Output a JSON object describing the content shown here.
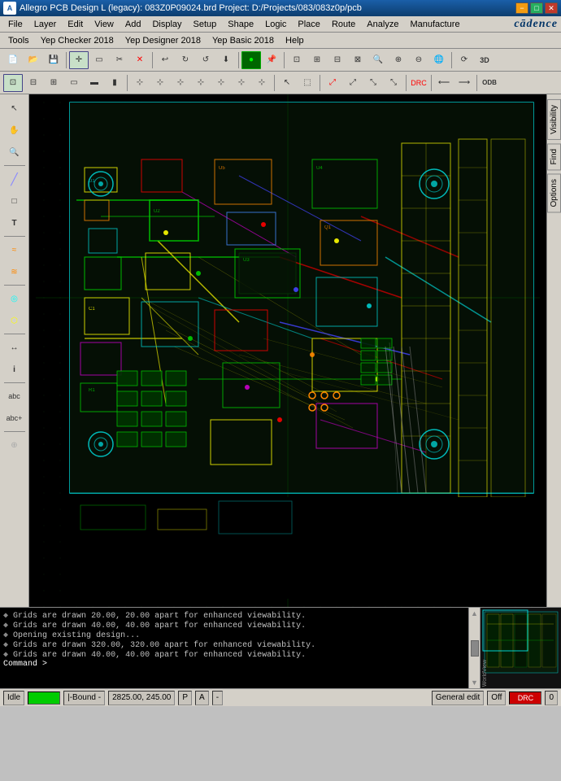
{
  "titlebar": {
    "icon": "A",
    "title": "Allegro PCB Design L (legacy): 083Z0P09024.brd  Project: D:/Projects/083/083z0p/pcb",
    "btn_min": "−",
    "btn_max": "□",
    "btn_close": "✕"
  },
  "menubar1": {
    "items": [
      "File",
      "Layer",
      "Edit",
      "View",
      "Add",
      "Display",
      "Setup",
      "Shape",
      "Logic",
      "Place",
      "Route",
      "Analyze",
      "Manufacture"
    ]
  },
  "menubar2": {
    "items": [
      "Tools",
      "Yep Checker 2018",
      "Yep Designer 2018",
      "Yep Basic 2018",
      "Help"
    ]
  },
  "right_panel": {
    "tabs": [
      "Visibility",
      "Find",
      "Options"
    ]
  },
  "console": {
    "lines": [
      "Grids are drawn 20.00, 20.00 apart for enhanced viewability.",
      "Grids are drawn 40.00, 40.00 apart for enhanced viewability.",
      "Opening existing design...",
      "Grids are drawn 320.00, 320.00 apart for enhanced viewability.",
      "Grids are drawn 40.00, 40.00 apart for enhanced viewability.",
      "Command >"
    ],
    "label_prefix": "Command"
  },
  "minimap": {
    "label": "WorldView"
  },
  "statusbar": {
    "idle": "Idle",
    "green_indicator": "",
    "bound_label": "|-Bound -",
    "coordinates": "2825.00, 245.00",
    "p_label": "P",
    "a_label": "A",
    "dash": "-",
    "general_edit": "General edit",
    "off": "Off",
    "red_indicator": "DRC",
    "zero": "0"
  }
}
